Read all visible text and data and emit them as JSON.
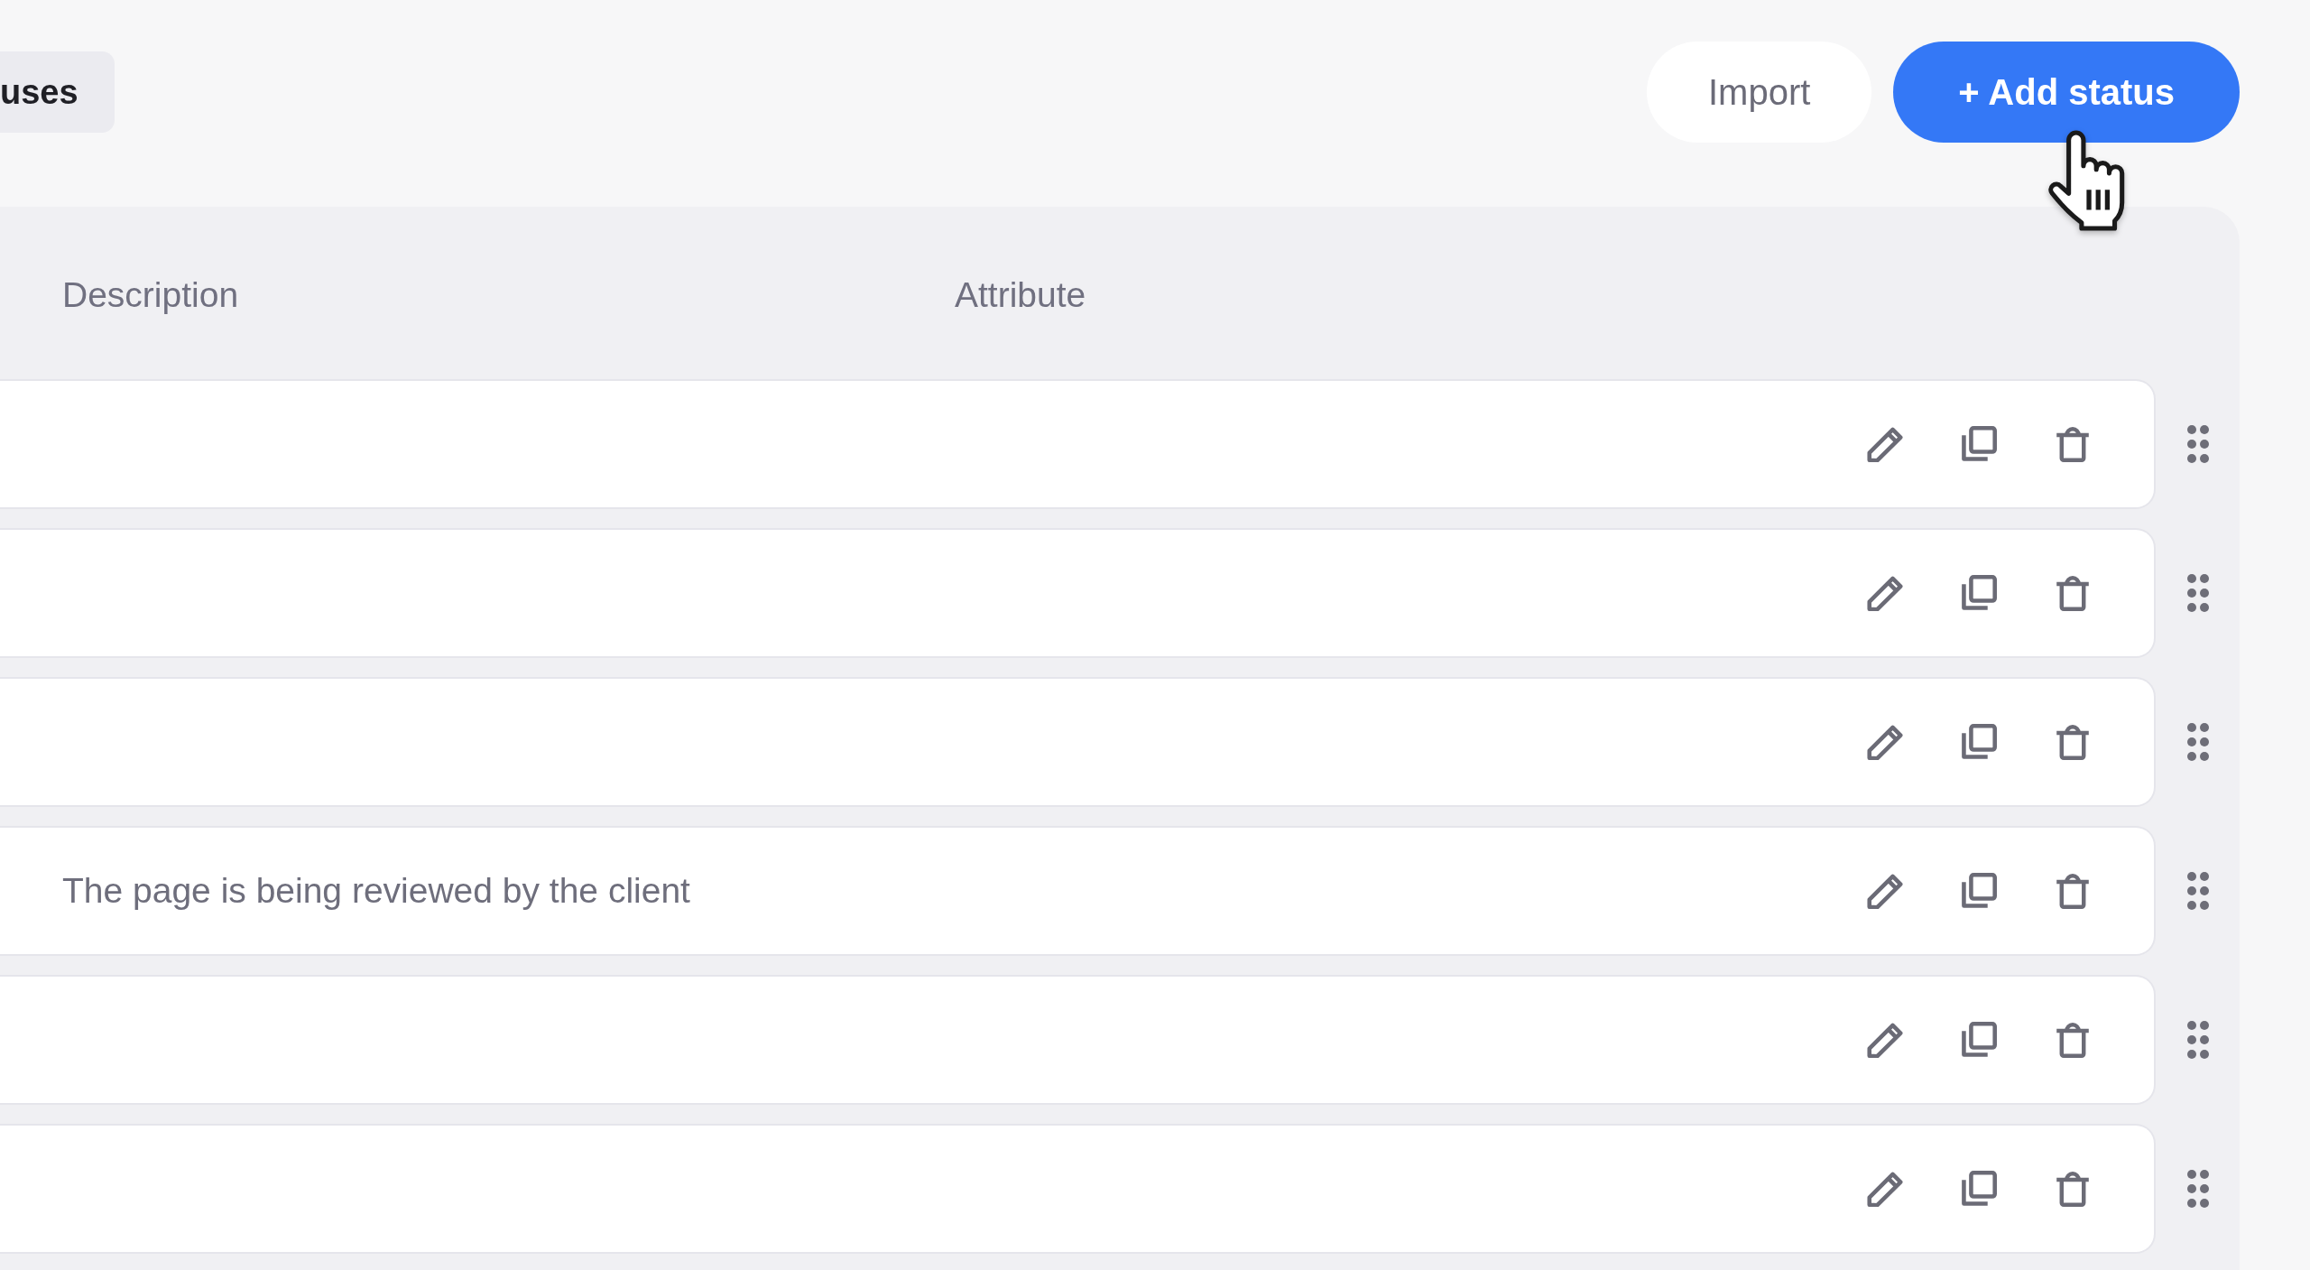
{
  "tabs": [
    {
      "label": "uses",
      "selected": true
    }
  ],
  "toolbar": {
    "buttons": [
      {
        "label": "Import",
        "kind": "secondary"
      },
      {
        "label": "+ Add status",
        "kind": "primary"
      }
    ]
  },
  "table": {
    "columns": [
      "Description",
      "Attribute"
    ],
    "rows": [
      {},
      {},
      {},
      {
        "description": "The page is being reviewed by the client"
      },
      {},
      {}
    ]
  }
}
